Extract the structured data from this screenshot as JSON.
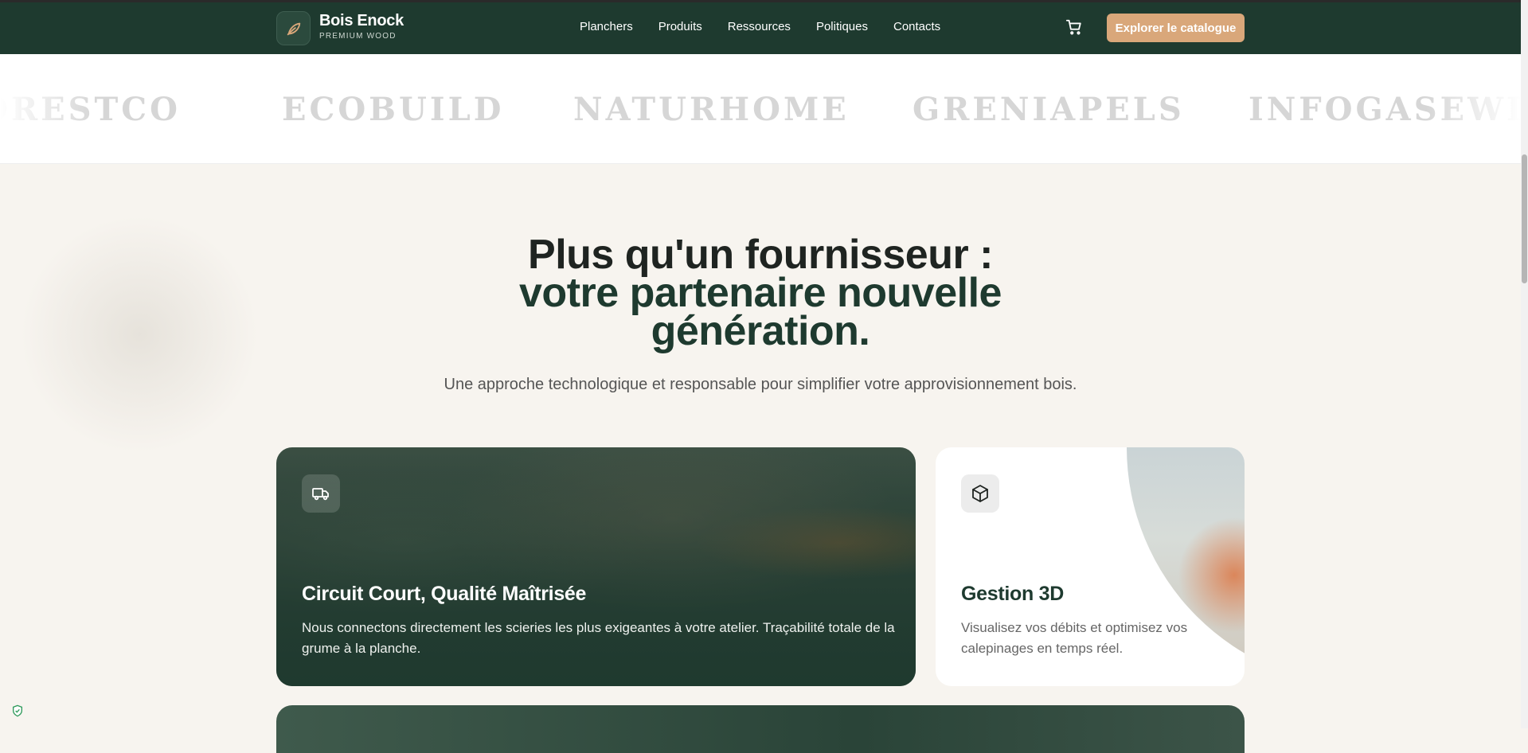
{
  "header": {
    "brand_name": "Bois Enock",
    "brand_sub": "PREMIUM WOOD",
    "nav": [
      "Planchers",
      "Produits",
      "Ressources",
      "Politiques",
      "Contacts"
    ],
    "cta_label": "Explorer le catalogue",
    "colors": {
      "bar": "#1e3a2f",
      "cta": "#d9a77a"
    }
  },
  "partners": [
    "ORESTCO",
    "ECOBUILD",
    "NATURHOME",
    "GRENIAPELS",
    "INFOGASEWIE"
  ],
  "hero": {
    "line1": "Plus qu'un fournisseur :",
    "line2": "votre partenaire nouvelle génération.",
    "subtitle": "Une approche technologique et responsable pour simplifier votre approvisionnement bois."
  },
  "cards": [
    {
      "icon": "truck-icon",
      "title": "Circuit Court, Qualité Maîtrisée",
      "text": "Nous connectons directement les scieries les plus exigeantes à votre atelier. Traçabilité totale de la grume à la planche."
    },
    {
      "icon": "cube-icon",
      "title": "Gestion 3D",
      "text": "Visualisez vos débits et optimisez vos calepinages en temps réel."
    }
  ]
}
